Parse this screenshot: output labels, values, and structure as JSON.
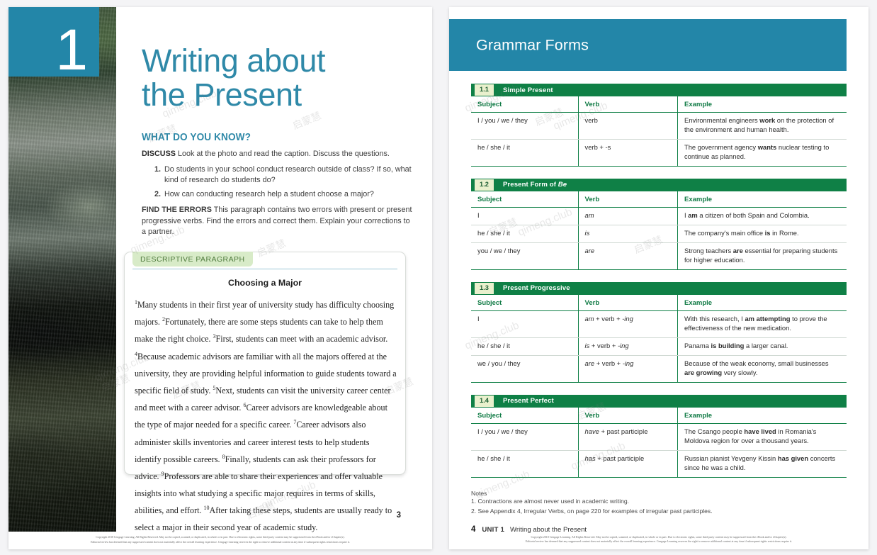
{
  "left_page": {
    "chapter_number": "1",
    "chapter_title_line1": "Writing about",
    "chapter_title_line2": "the Present",
    "section_heading": "WHAT DO YOU KNOW?",
    "discuss_label": "DISCUSS",
    "discuss_text": "Look at the photo and read the caption. Discuss the questions.",
    "questions": [
      {
        "num": "1.",
        "text": "Do students in your school conduct research outside of class? If so, what kind of research do students do?"
      },
      {
        "num": "2.",
        "text": "How can conducting research help a student choose a major?"
      }
    ],
    "find_errors_label": "FIND THE ERRORS",
    "find_errors_text": "This paragraph contains two errors with present or present progressive verbs. Find the errors and correct them. Explain your corrections to a partner.",
    "model": {
      "tag": "DESCRIPTIVE PARAGRAPH",
      "title": "Choosing a Major",
      "sentences": [
        {
          "n": "1",
          "text": "Many students in their first year of university study has difficulty choosing majors."
        },
        {
          "n": "2",
          "text": "Fortunately, there are some steps students can take to help them make the right choice."
        },
        {
          "n": "3",
          "text": "First, students can meet with an academic advisor."
        },
        {
          "n": "4",
          "text": "Because academic advisors are familiar with all the majors offered at the university, they are providing helpful information to guide students toward a specific field of study."
        },
        {
          "n": "5",
          "text": "Next, students can visit the university career center and meet with a career advisor."
        },
        {
          "n": "6",
          "text": "Career advisors are knowledgeable about the type of major needed for a specific career."
        },
        {
          "n": "7",
          "text": "Career advisors also administer skills inventories and career interest tests to help students identify possible careers."
        },
        {
          "n": "8",
          "text": "Finally, students can ask their professors for advice."
        },
        {
          "n": "9",
          "text": "Professors are able to share their experiences and offer valuable insights into what studying a specific major requires in terms of skills, abilities, and effort."
        },
        {
          "n": "10",
          "text": "After taking these steps, students are usually ready to select a major in their second year of academic study."
        }
      ]
    },
    "page_number": "3",
    "copyright_line1": "Copyright 2018 Cengage Learning. All Rights Reserved. May not be copied, scanned, or duplicated, in whole or in part. Due to electronic rights, some third party content may be suppressed from the eBook and/or eChapter(s).",
    "copyright_line2": "Editorial review has deemed that any suppressed content does not materially affect the overall learning experience. Cengage Learning reserves the right to remove additional content at any time if subsequent rights restrictions require it."
  },
  "right_page": {
    "header_title": "Grammar Forms",
    "tables": [
      {
        "number": "1.1",
        "title": "Simple Present",
        "title_italic": "",
        "headers": [
          "Subject",
          "Verb",
          "Example"
        ],
        "rows": [
          {
            "subject": "I / you / we / they",
            "verb": "verb",
            "verb_italic": "",
            "example_pre": "Environmental engineers ",
            "example_bold": "work",
            "example_post": " on the protection of the environment and human health."
          },
          {
            "subject": "he / she / it",
            "verb": "verb + -s",
            "verb_italic": "",
            "example_pre": "The government agency ",
            "example_bold": "wants",
            "example_post": " nuclear testing to continue as planned."
          }
        ]
      },
      {
        "number": "1.2",
        "title": "Present Form of ",
        "title_italic": "Be",
        "headers": [
          "Subject",
          "Verb",
          "Example"
        ],
        "rows": [
          {
            "subject": "I",
            "verb": "",
            "verb_italic": "am",
            "example_pre": "I ",
            "example_bold": "am",
            "example_post": " a citizen of both Spain and Colombia."
          },
          {
            "subject": "he / she / it",
            "verb": "",
            "verb_italic": "is",
            "example_pre": "The company's main office ",
            "example_bold": "is",
            "example_post": " in Rome."
          },
          {
            "subject": "you / we / they",
            "verb": "",
            "verb_italic": "are",
            "example_pre": "Strong teachers ",
            "example_bold": "are",
            "example_post": " essential for preparing students for higher education."
          }
        ]
      },
      {
        "number": "1.3",
        "title": "Present Progressive",
        "title_italic": "",
        "headers": [
          "Subject",
          "Verb",
          "Example"
        ],
        "rows": [
          {
            "subject": "I",
            "verb_italic": "am",
            "verb_mid": " + verb + ",
            "verb_italic2": "-ing",
            "example_pre": "With this research, I ",
            "example_bold": "am attempting",
            "example_post": " to prove the effectiveness of the new medication."
          },
          {
            "subject": "he / she / it",
            "verb_italic": "is",
            "verb_mid": " + verb + ",
            "verb_italic2": "-ing",
            "example_pre": "Panama ",
            "example_bold": "is building",
            "example_post": " a larger canal."
          },
          {
            "subject": "we / you / they",
            "verb_italic": "are",
            "verb_mid": " + verb + ",
            "verb_italic2": "-ing",
            "example_pre": "Because of the weak economy, small businesses ",
            "example_bold": "are growing",
            "example_post": " very slowly."
          }
        ]
      },
      {
        "number": "1.4",
        "title": "Present Perfect",
        "title_italic": "",
        "headers": [
          "Subject",
          "Verb",
          "Example"
        ],
        "rows": [
          {
            "subject": "I / you / we / they",
            "verb_italic": "have",
            "verb_mid": " + past participle",
            "verb_italic2": "",
            "example_pre": "The Csango people ",
            "example_bold": "have lived",
            "example_post": " in Romania's Moldova region for over a thousand years."
          },
          {
            "subject": "he / she / it",
            "verb_italic": "has",
            "verb_mid": " + past participle",
            "verb_italic2": "",
            "example_pre": "Russian pianist Yevgeny Kissin ",
            "example_bold": "has given",
            "example_post": " concerts since he was a child."
          }
        ]
      }
    ],
    "notes_heading": "Notes",
    "notes": [
      "1. Contractions are almost never used in academic writing.",
      "2. See Appendix 4, Irregular Verbs, on page 220 for examples of irregular past participles."
    ],
    "folio_page": "4",
    "folio_unit": "UNIT 1",
    "folio_title": "Writing about the Present",
    "copyright_line1": "Copyright 2018 Cengage Learning. All Rights Reserved. May not be copied, scanned, or duplicated, in whole or in part. Due to electronic rights, some third party content may be suppressed from the eBook and/or eChapter(s).",
    "copyright_line2": "Editorial review has deemed that any suppressed content does not materially affect the overall learning experience. Cengage Learning reserves the right to remove additional content at any time if subsequent rights restrictions require it."
  },
  "watermarks": [
    "qimeng.club",
    "启蒙慧"
  ],
  "colors": {
    "teal": "#2386a8",
    "green_bar": "#0f8046",
    "badge_bg": "#e9f0cd",
    "tag_bg": "#d8ebc8",
    "page_bg": "#f4f4f6"
  }
}
